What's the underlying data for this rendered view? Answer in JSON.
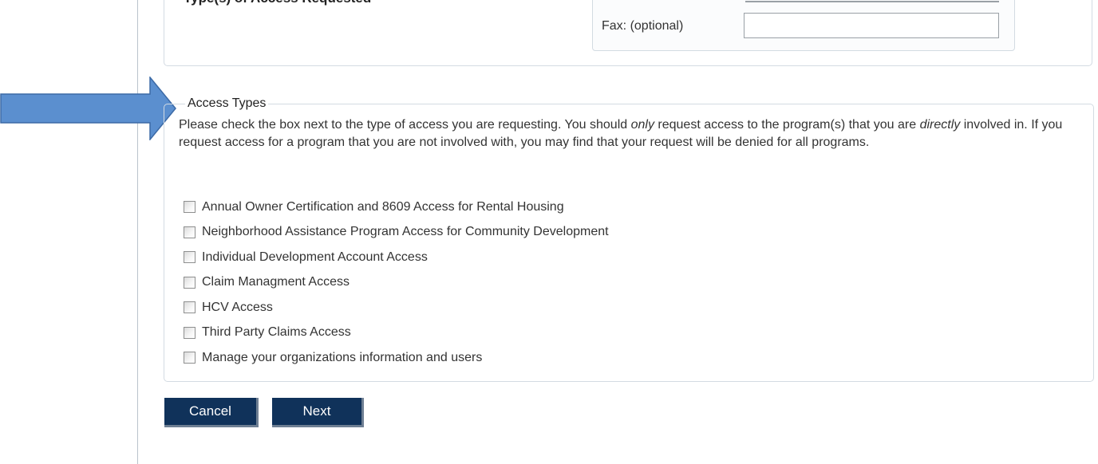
{
  "top_section": {
    "partial_heading": "Type(s) of Access Requested",
    "fax_label": "Fax: (optional)",
    "fax_value": ""
  },
  "access_types": {
    "legend": "Access Types",
    "instructions": {
      "part1": "Please check the box next to the type of access you are requesting. You should ",
      "only": "only",
      "part2": " request access to the program(s) that you are ",
      "directly": "directly",
      "part3": " involved in. If you request access for a program that you are not involved with, you may find that your request will be denied for all programs."
    },
    "options": [
      {
        "label": "Annual Owner Certification and 8609 Access for Rental Housing",
        "checked": false
      },
      {
        "label": "Neighborhood Assistance Program Access for Community Development",
        "checked": false
      },
      {
        "label": "Individual Development Account Access",
        "checked": false
      },
      {
        "label": "Claim Managment Access",
        "checked": false
      },
      {
        "label": "HCV Access",
        "checked": false
      },
      {
        "label": "Third Party Claims Access",
        "checked": false
      },
      {
        "label": "Manage your organizations information and users",
        "checked": false
      }
    ]
  },
  "buttons": {
    "cancel_label": "Cancel",
    "next_label": "Next"
  },
  "colors": {
    "button_bg": "#10325a",
    "arrow_fill": "#5b8fcf",
    "arrow_stroke": "#3c6aa6"
  },
  "icons": {
    "annotation": "arrow-right-icon"
  }
}
